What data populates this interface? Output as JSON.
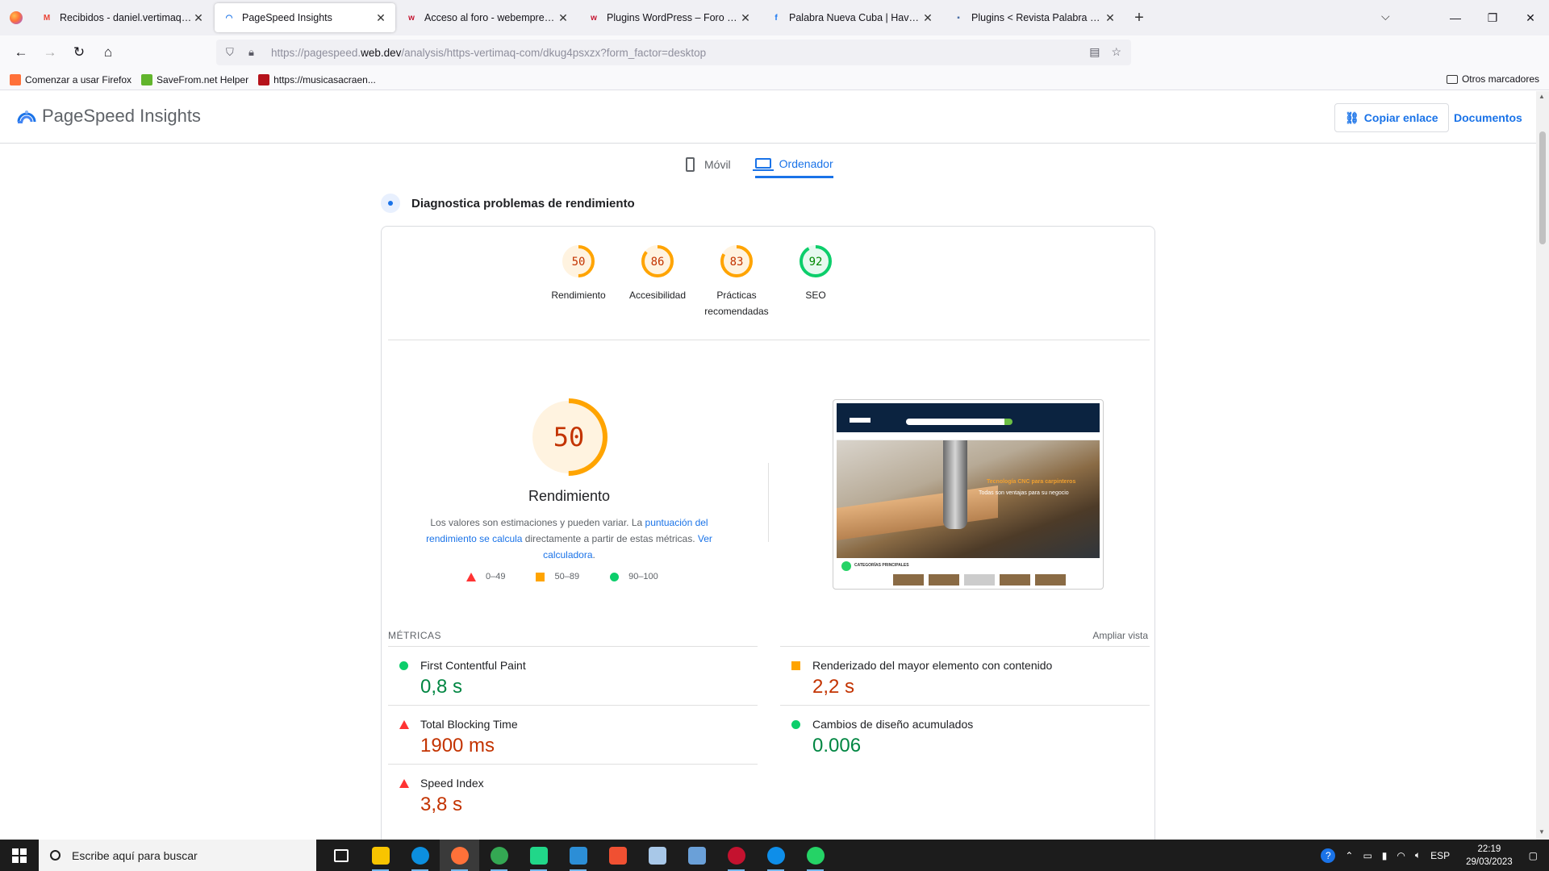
{
  "browser": {
    "tabs": [
      {
        "title": "Recibidos - daniel.vertimaq@gmail.com",
        "icon": "gmail-icon",
        "color": "#ea4335",
        "glyph": "M",
        "active": false
      },
      {
        "title": "PageSpeed Insights",
        "icon": "pagespeed-icon",
        "color": "#1a73e8",
        "glyph": "◠",
        "active": true
      },
      {
        "title": "Acceso al foro - webempresa.com",
        "icon": "webempresa-icon",
        "color": "#c4122f",
        "glyph": "w",
        "active": false
      },
      {
        "title": "Plugins WordPress – Foro Webempresa",
        "icon": "webempresa-icon",
        "color": "#c4122f",
        "glyph": "w",
        "active": false
      },
      {
        "title": "Palabra Nueva Cuba | Havana | Facebook",
        "icon": "facebook-icon",
        "color": "#1877f2",
        "glyph": "f",
        "active": false
      },
      {
        "title": "Plugins < Revista Palabra Nueva",
        "icon": "site-icon",
        "color": "#4a6fa5",
        "glyph": "▪",
        "active": false
      }
    ],
    "new_tab": "+",
    "url_prefix": "https://pagespeed.",
    "url_domain": "web.dev",
    "url_suffix": "/analysis/https-vertimaq-com/dkug4psxzx?form_factor=desktop",
    "bookmarks": [
      {
        "label": "Comenzar a usar Firefox",
        "color": "#ff7139"
      },
      {
        "label": "SaveFrom.net Helper",
        "color": "#62b52d"
      },
      {
        "label": "https://musicasacraen...",
        "color": "#b5121b"
      }
    ],
    "other_bookmarks": "Otros marcadores",
    "extensions": [
      {
        "name": "download-icon",
        "color": "#5b5b66",
        "glyph": "⤓"
      },
      {
        "name": "ext-mask-icon",
        "color": "#333333",
        "glyph": "◉"
      },
      {
        "name": "ext-percent-icon",
        "color": "#f16529",
        "glyph": "%"
      },
      {
        "name": "ext-blue-icon",
        "color": "#2b7de9",
        "glyph": "2"
      },
      {
        "name": "ext-tool-icon",
        "color": "#555555",
        "glyph": "5"
      },
      {
        "name": "ext-s-icon",
        "color": "#d93025",
        "glyph": "S"
      },
      {
        "name": "ext-green-icon",
        "color": "#62b52d",
        "glyph": "↓"
      },
      {
        "name": "ext-shield-icon",
        "color": "#c4122f",
        "glyph": "◆"
      },
      {
        "name": "ext-guard-icon",
        "color": "#0f9d58",
        "glyph": "●"
      },
      {
        "name": "extensions-icon",
        "color": "#5b5b66",
        "glyph": "✣"
      },
      {
        "name": "menu-icon",
        "color": "#5b5b66",
        "glyph": "≡"
      }
    ]
  },
  "psi": {
    "app_name": "PageSpeed Insights",
    "copy_link": "Copiar enlace",
    "docs": "Documentos",
    "device_tabs": {
      "mobile": "Móvil",
      "desktop": "Ordenador"
    },
    "diagnose": "Diagnostica problemas de rendimiento",
    "scores": [
      {
        "label": "Rendimiento",
        "value": 50,
        "color": "#ffa400",
        "text_color": "#c33300"
      },
      {
        "label": "Accesibilidad",
        "value": 86,
        "color": "#ffa400",
        "text_color": "#c33300"
      },
      {
        "label": "Prácticas recomendadas",
        "value": 83,
        "color": "#ffa400",
        "text_color": "#c33300"
      },
      {
        "label": "SEO",
        "value": 92,
        "color": "#0cce6b",
        "text_color": "#008800"
      }
    ],
    "main_score": {
      "value": 50,
      "label": "Rendimiento",
      "color": "#ffa400",
      "text_color": "#c33300"
    },
    "desc": {
      "part1": "Los valores son estimaciones y pueden variar. La ",
      "link1": "puntuación del rendimiento se calcula",
      "part2": " directamente a partir de estas métricas. ",
      "link2": "Ver calculadora",
      "part3": "."
    },
    "legend": [
      {
        "label": "0–49",
        "shape": "triangle",
        "color": "#ff3333"
      },
      {
        "label": "50–89",
        "shape": "square",
        "color": "#ffa400"
      },
      {
        "label": "90–100",
        "shape": "circle",
        "color": "#0cce6b"
      }
    ],
    "screenshot": {
      "caption1": "Tecnología CNC para carpinteros",
      "caption2": "Todas son ventajas para su negocio",
      "categories": "CATEGORÍAS PRINCIPALES"
    },
    "metrics_heading": "MÉTRICAS",
    "expand_view": "Ampliar vista",
    "metrics": [
      {
        "name": "First Contentful Paint",
        "value": "0,8 s",
        "status": "good"
      },
      {
        "name": "Renderizado del mayor elemento con contenido",
        "value": "2,2 s",
        "status": "average"
      },
      {
        "name": "Total Blocking Time",
        "value": "1900 ms",
        "status": "poor"
      },
      {
        "name": "Cambios de diseño acumulados",
        "value": "0.006",
        "status": "good"
      },
      {
        "name": "Speed Index",
        "value": "3,8 s",
        "status": "poor"
      }
    ]
  },
  "taskbar": {
    "search_placeholder": "Escribe aquí para buscar",
    "apps": [
      {
        "name": "task-view-icon",
        "color": "#ffffff"
      },
      {
        "name": "file-explorer-icon",
        "color": "#f8c400"
      },
      {
        "name": "edge-icon",
        "color": "#0c8fdf"
      },
      {
        "name": "firefox-icon",
        "color": "#ff7139"
      },
      {
        "name": "chrome-icon",
        "color": "#34a853"
      },
      {
        "name": "pycharm-icon",
        "color": "#21d789"
      },
      {
        "name": "vscode-icon",
        "color": "#2c8ed6"
      },
      {
        "name": "git-icon",
        "color": "#f05032"
      },
      {
        "name": "app-icon",
        "color": "#a8c8e8"
      },
      {
        "name": "control-panel-icon",
        "color": "#6aa0d8"
      },
      {
        "name": "app-red-icon",
        "color": "#c4122f"
      },
      {
        "name": "teamviewer-icon",
        "color": "#0e8ee9"
      },
      {
        "name": "whatsapp-icon",
        "color": "#25d366"
      }
    ],
    "lang": "ESP",
    "time": "22:19",
    "date": "29/03/2023"
  }
}
